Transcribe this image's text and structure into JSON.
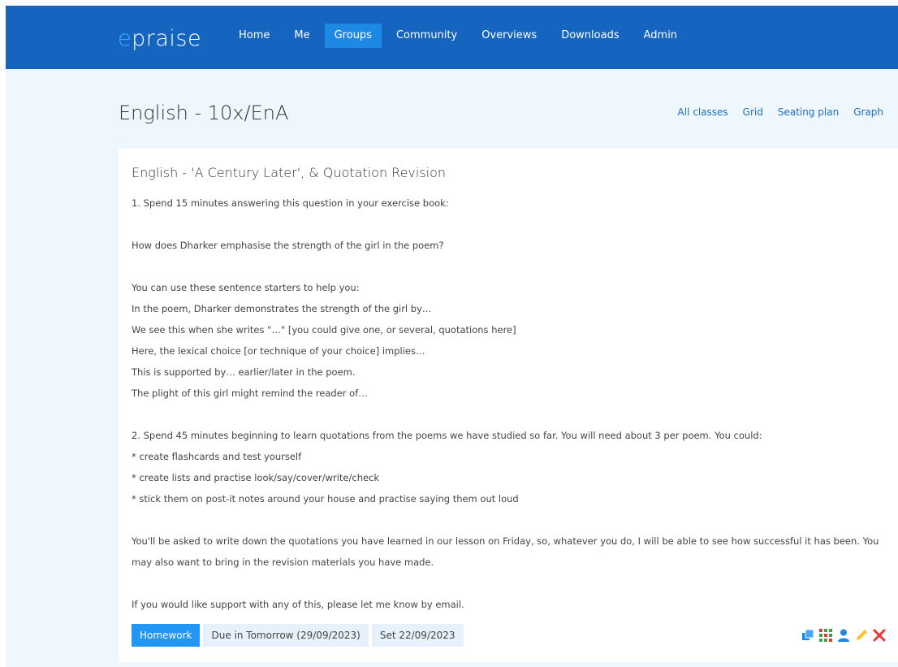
{
  "brand": {
    "prefix": "e",
    "rest": "praise"
  },
  "nav": [
    {
      "label": "Home"
    },
    {
      "label": "Me"
    },
    {
      "label": "Groups",
      "active": true
    },
    {
      "label": "Community"
    },
    {
      "label": "Overviews"
    },
    {
      "label": "Downloads"
    },
    {
      "label": "Admin"
    }
  ],
  "page": {
    "title": "English - 10x/EnA",
    "views": [
      "All classes",
      "Grid",
      "Seating plan",
      "Graph"
    ]
  },
  "task": {
    "title": "English - 'A Century Later', & Quotation Revision",
    "lines": [
      "1. Spend 15 minutes answering this question in your exercise book:",
      "",
      "How does Dharker emphasise the strength of the girl in the poem?",
      "",
      "You can use these sentence starters to help you:",
      "In the poem, Dharker demonstrates the strength of the girl by…",
      "We see this when she writes \"…\" [you could give one, or several, quotations here]",
      "Here, the lexical choice [or technique of your choice] implies…",
      "This is supported by… earlier/later in the poem.",
      "The plight of this girl might remind the reader of…",
      "",
      "2. Spend 45 minutes beginning to learn quotations from the poems we have studied so far. You will need about 3 per poem. You could:",
      "* create flashcards and test yourself",
      "* create lists and practise look/say/cover/write/check",
      "* stick them on post-it notes around your house and practise saying them out loud",
      "",
      "You'll be asked to write down the quotations you have learned in our lesson on Friday, so, whatever you do, I will be able to see how successful it has been. You may also want to bring in the revision materials you have made.",
      "",
      "If you would like support with any of this, please let me know by email."
    ],
    "type_label": "Homework",
    "due_label": "Due in Tomorrow (29/09/2023)",
    "set_label": "Set 22/09/2023"
  },
  "actions": [
    "copy-icon",
    "grid-icon",
    "person-icon",
    "pencil-icon",
    "close-icon"
  ],
  "colors": {
    "navbar": "#1565c0",
    "accent": "#3fa9f5",
    "page_bg": "#eef6fe",
    "primary_tag": "#2196f3"
  }
}
